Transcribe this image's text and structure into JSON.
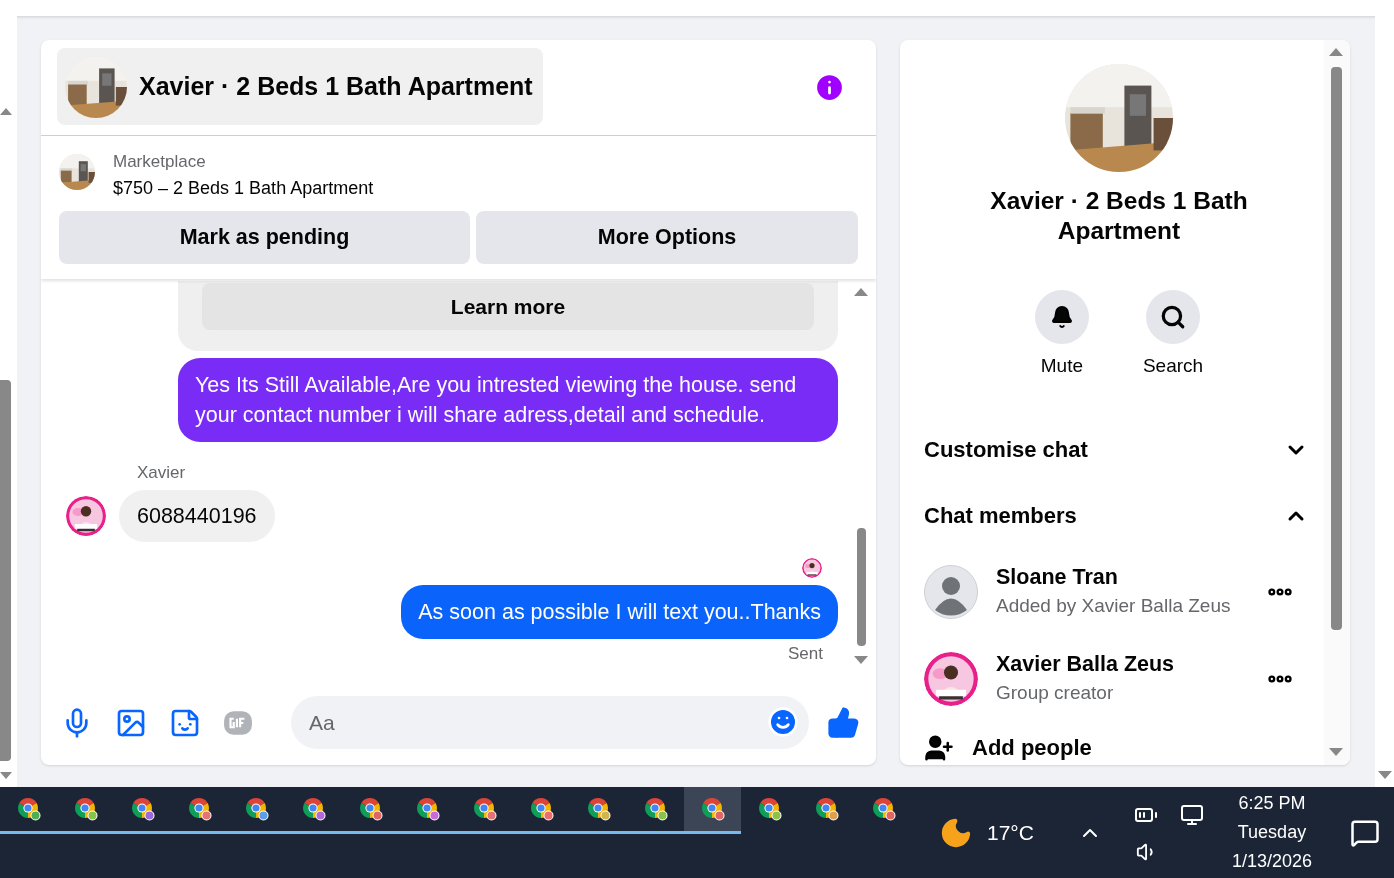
{
  "chat": {
    "title": "Xavier · 2 Beds 1 Bath Apartment",
    "listing": {
      "source": "Marketplace",
      "title": "$750 – 2 Beds 1 Bath Apartment"
    },
    "actions": [
      "Mark as pending",
      "More Options"
    ],
    "messages": [
      {
        "kind": "card_button",
        "text": "Learn more"
      },
      {
        "kind": "outgoing",
        "text": "Yes Its Still Available,Are you intrested viewing the house. send your contact number i will share adress,detail and schedule.",
        "color": "#7a2cf7"
      },
      {
        "kind": "sender_name",
        "text": "Xavier"
      },
      {
        "kind": "incoming",
        "text": "6088440196"
      },
      {
        "kind": "read_receipt"
      },
      {
        "kind": "outgoing",
        "text": "As soon as possible I will text you..Thanks",
        "color": "#0a64fb"
      },
      {
        "kind": "status",
        "text": "Sent"
      }
    ],
    "composer": {
      "placeholder": "Aa"
    }
  },
  "details": {
    "title": "Xavier · 2 Beds 1 Bath Apartment",
    "actions": [
      "Mute",
      "Search"
    ],
    "sections": [
      {
        "label": "Customise chat",
        "expanded": false
      },
      {
        "label": "Chat members",
        "expanded": true
      }
    ],
    "members": [
      {
        "name": "Sloane Tran",
        "subtitle": "Added by Xavier Balla Zeus",
        "kind": "default"
      },
      {
        "name": "Xavier Balla Zeus",
        "subtitle": "Group creator"
      }
    ],
    "add_people": "Add people"
  },
  "taskbar": {
    "apps": [
      {
        "running": true,
        "selected": false,
        "color": "#4caf50"
      },
      {
        "running": true,
        "selected": false,
        "color": "#8bc34a"
      },
      {
        "running": true,
        "selected": false,
        "color": "#9c6ade"
      },
      {
        "running": true,
        "selected": false,
        "color": "#e57373"
      },
      {
        "running": true,
        "selected": false,
        "color": "#5c9ded"
      },
      {
        "running": true,
        "selected": false,
        "color": "#b06ad8"
      },
      {
        "running": true,
        "selected": false,
        "color": "#e06666"
      },
      {
        "running": true,
        "selected": false,
        "color": "#c86dd7"
      },
      {
        "running": true,
        "selected": false,
        "color": "#e57373"
      },
      {
        "running": true,
        "selected": false,
        "color": "#ef6c6c"
      },
      {
        "running": true,
        "selected": false,
        "color": "#d4b24c"
      },
      {
        "running": true,
        "selected": false,
        "color": "#8bc34a"
      },
      {
        "running": true,
        "selected": true,
        "color": "#e06666"
      },
      {
        "running": false,
        "selected": false,
        "color": "#8bc34a"
      },
      {
        "running": false,
        "selected": false,
        "color": "#e0a050"
      },
      {
        "running": false,
        "selected": false,
        "color": "#e06666"
      }
    ],
    "weather": "17°C",
    "time": "6:25 PM",
    "day": "Tuesday",
    "date": "1/13/2026"
  }
}
